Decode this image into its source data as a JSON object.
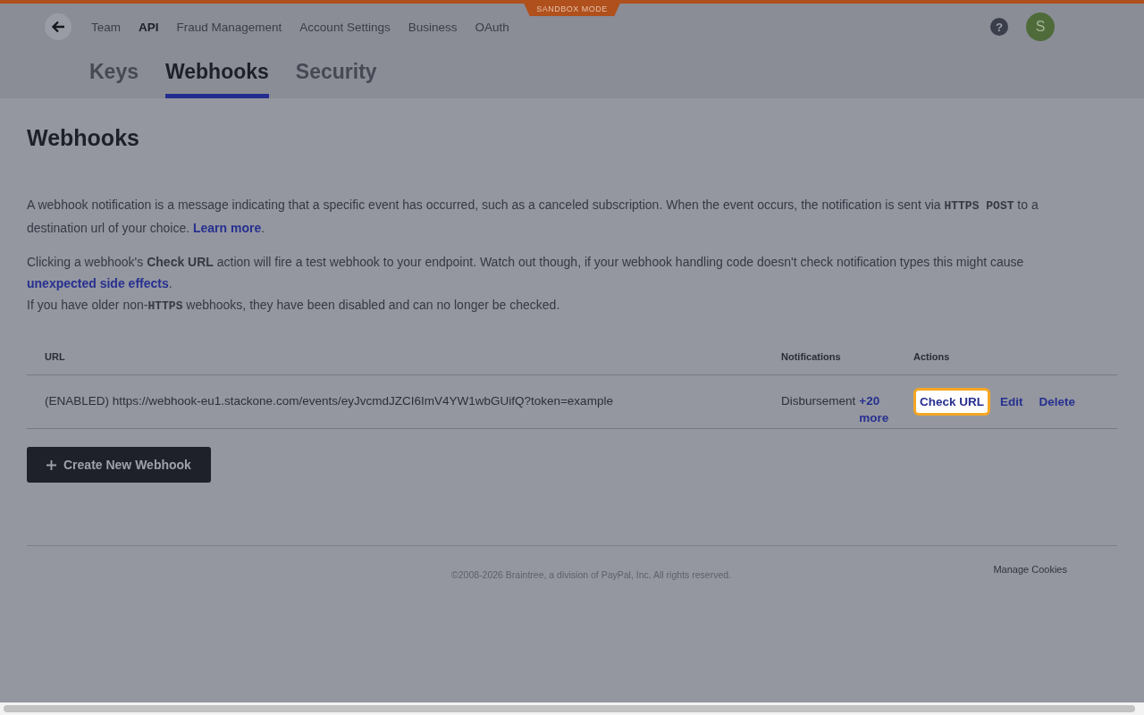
{
  "sandbox_badge": "SANDBOX MODE",
  "nav": {
    "items": [
      {
        "label": "Team",
        "selected": false
      },
      {
        "label": "API",
        "selected": true
      },
      {
        "label": "Fraud Management",
        "selected": false
      },
      {
        "label": "Account Settings",
        "selected": false
      },
      {
        "label": "Business",
        "selected": false
      },
      {
        "label": "OAuth",
        "selected": false
      }
    ],
    "help": "?",
    "avatar": "S"
  },
  "tabs": [
    {
      "label": "Keys",
      "selected": false
    },
    {
      "label": "Webhooks",
      "selected": true
    },
    {
      "label": "Security",
      "selected": false
    }
  ],
  "page_title": "Webhooks",
  "paragraphs": [
    {
      "segments": [
        {
          "kind": "text",
          "text": "A webhook notification is a message indicating that a specific event has occurred, such as a canceled subscription. When the event occurs, the notification is sent via "
        },
        {
          "kind": "code",
          "text": "HTTPS POST"
        },
        {
          "kind": "text",
          "text": " to a destination url of your choice. "
        },
        {
          "kind": "link",
          "text": "Learn more"
        },
        {
          "kind": "text",
          "text": "."
        }
      ]
    },
    {
      "segments": [
        {
          "kind": "text",
          "text": "Clicking a webhook's "
        },
        {
          "kind": "bold",
          "text": "Check URL"
        },
        {
          "kind": "text",
          "text": " action will fire a test webhook to your endpoint. Watch out though, if your webhook handling code doesn't check notification types this might cause "
        },
        {
          "kind": "link",
          "text": "unexpected side effects"
        },
        {
          "kind": "text",
          "text": "."
        },
        {
          "kind": "break"
        },
        {
          "kind": "text",
          "text": "If you have older non-"
        },
        {
          "kind": "code",
          "text": "HTTPS"
        },
        {
          "kind": "text",
          "text": " webhooks, they have been disabled and can no longer be checked."
        }
      ]
    }
  ],
  "table": {
    "columns": [
      "URL",
      "Notifications",
      "Actions"
    ],
    "rows": [
      {
        "url": "(ENABLED) https://webhook-eu1.stackone.com/events/eyJvcmdJZCI6ImV4YW1wbGUifQ?token=example",
        "notification": "Disbursement",
        "more": "+20 more",
        "actions": [
          {
            "label": "Check URL",
            "highlighted": true
          },
          {
            "label": "Edit",
            "highlighted": false
          },
          {
            "label": "Delete",
            "highlighted": false
          }
        ]
      }
    ]
  },
  "create_button": "Create New Webhook",
  "footer": {
    "copyright": "©2008-2026 Braintree, a division of PayPal, Inc. All rights reserved.",
    "manage_cookies": "Manage Cookies"
  }
}
